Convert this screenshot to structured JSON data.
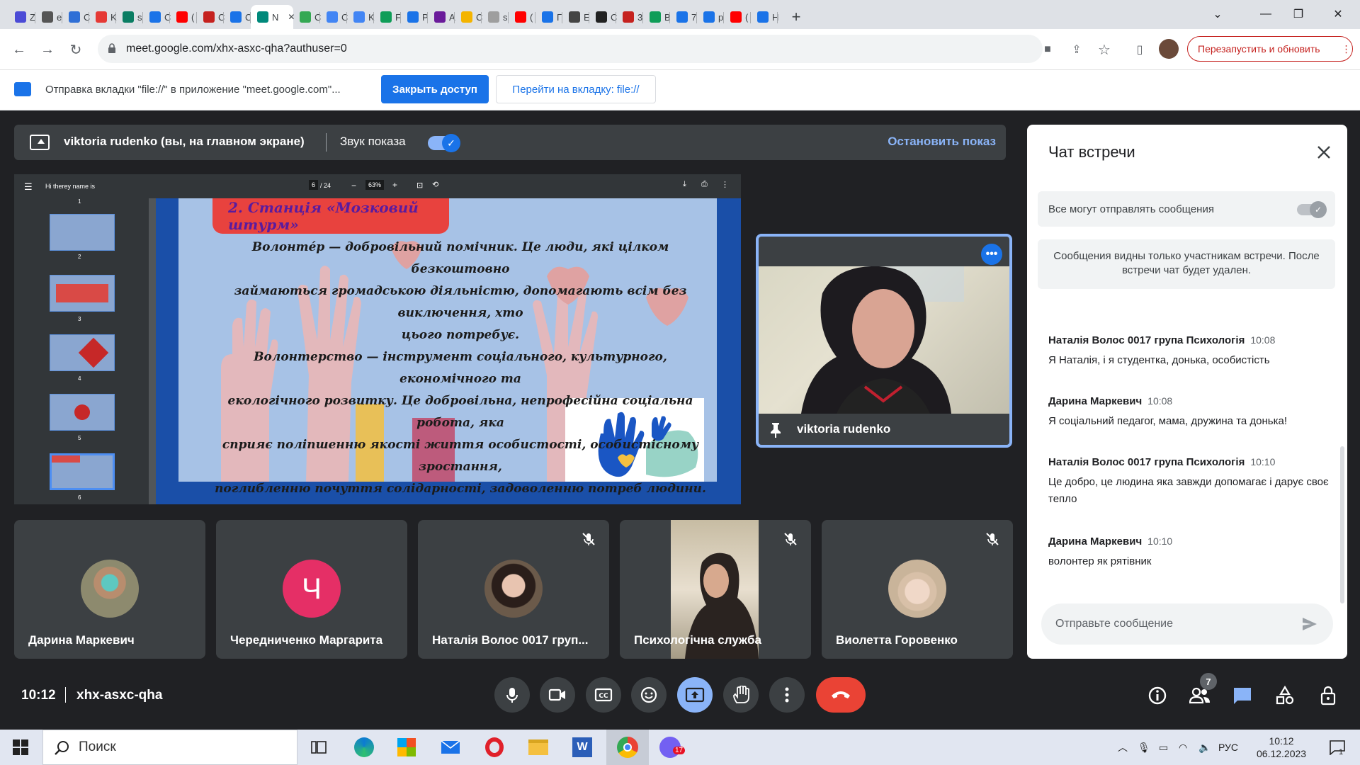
{
  "browser": {
    "tabs": [
      {
        "letter": "Z",
        "color": "#4b4bd6"
      },
      {
        "letter": "e",
        "color": "#555"
      },
      {
        "letter": "C",
        "color": "#2f6fd6"
      },
      {
        "letter": "K",
        "color": "#e53935"
      },
      {
        "letter": "s",
        "color": "#0a7d63"
      },
      {
        "letter": "C",
        "color": "#1a73e8"
      },
      {
        "letter": "(",
        "color": "#ff0000"
      },
      {
        "letter": "C",
        "color": "#c5221f"
      },
      {
        "letter": "C",
        "color": "#1a73e8"
      },
      {
        "letter": "N",
        "color": "#00897b",
        "active": true
      },
      {
        "letter": "C",
        "color": "#34a853"
      },
      {
        "letter": "C",
        "color": "#4285f4"
      },
      {
        "letter": "K",
        "color": "#4285f4"
      },
      {
        "letter": "F",
        "color": "#0f9d58"
      },
      {
        "letter": "P",
        "color": "#1a73e8"
      },
      {
        "letter": "A",
        "color": "#6a1b9a"
      },
      {
        "letter": "C",
        "color": "#f4b400"
      },
      {
        "letter": "s",
        "color": "#9e9e9e"
      },
      {
        "letter": "(",
        "color": "#ff0000"
      },
      {
        "letter": "Г",
        "color": "#1a73e8"
      },
      {
        "letter": "E",
        "color": "#444"
      },
      {
        "letter": "C",
        "color": "#222"
      },
      {
        "letter": "3",
        "color": "#c5221f"
      },
      {
        "letter": "B",
        "color": "#0f9d58"
      },
      {
        "letter": "7",
        "color": "#1a73e8"
      },
      {
        "letter": "p",
        "color": "#1a73e8"
      },
      {
        "letter": "(",
        "color": "#ff0000"
      },
      {
        "letter": "H",
        "color": "#1a73e8"
      }
    ],
    "new_tab": "+",
    "url": "meet.google.com/xhx-asxc-qha?authuser=0",
    "relaunch_label": "Перезапустить и обновить",
    "infobar": {
      "text": "Отправка вкладки \"file://\" в приложение \"meet.google.com\"...",
      "close_access": "Закрыть доступ",
      "goto_tab": "Перейти на вкладку: file://"
    }
  },
  "meet": {
    "presenting": {
      "name": "viktoria rudenko (вы, на главном экране)",
      "sound_label": "Звук показа",
      "stop_label": "Остановить показ"
    },
    "pdf": {
      "filename": "Hi therey name is",
      "page": "6",
      "pages": "/ 24",
      "zoom": "63%",
      "thumb_numbers": [
        "1",
        "2",
        "3",
        "4",
        "5",
        "6"
      ]
    },
    "slide": {
      "title": "2. Станція «Мозковий штурм»",
      "lines": [
        "Волонтéр — добровільний помічник. Це люди, які цілком безкоштовно",
        "займаються громадською діяльністю, допомагають всім без виключення, хто",
        "цього потребує.",
        "Волонтерство — інструмент соціального, культурного, економічного та",
        "екологічного розвитку. Це добровільна, непрофесійна соціальна робота, яка",
        "сприяє поліпшенню якості життя особистості, особистісному зростання,",
        "поглибленню почуття солідарності, задоволенню потреб людини."
      ]
    },
    "pinned": {
      "name": "viktoria rudenko"
    },
    "participants": [
      {
        "name": "Дарина Маркевич",
        "avatar_color": "#8d8a6e",
        "muted": false
      },
      {
        "name": "Чередниченко Маргарита",
        "avatar_letter": "Ч",
        "avatar_color": "#e52f66",
        "muted": false
      },
      {
        "name": "Наталія Волос 0017 груп...",
        "avatar_color": "#6b5a4a",
        "muted": true
      },
      {
        "name": "Психологічна служба",
        "muted": true,
        "video": true
      },
      {
        "name": "Виолетта Горовенко",
        "avatar_color": "#c9b49a",
        "muted": true
      }
    ],
    "time": "10:12",
    "meeting_code": "xhx-asxc-qha",
    "people_count": "7",
    "chat": {
      "title": "Чат встречи",
      "allow_label": "Все могут отправлять сообщения",
      "notice": "Сообщения видны только участникам встречи. После встречи чат будет удален.",
      "messages": [
        {
          "sender": "Наталія Волос 0017 група Психологія",
          "time": "10:08",
          "text": "Я Наталія, і я студентка, донька, особистість"
        },
        {
          "sender": "Дарина Маркевич",
          "time": "10:08",
          "text": "Я соціальний педагог, мама, дружина та донька!"
        },
        {
          "sender": "Наталія Волос 0017 група Психологія",
          "time": "10:10",
          "text": "Це добро, це людина яка завжди допомагає і дарує своє тепло"
        },
        {
          "sender": "Дарина Маркевич",
          "time": "10:10",
          "text": "волонтер як рятівник"
        }
      ],
      "input_placeholder": "Отправьте сообщение"
    }
  },
  "taskbar": {
    "search_label": "Поиск",
    "lang": "РУС",
    "time": "10:12",
    "date": "06.12.2023",
    "notif_count": "1",
    "viber_badge": "17"
  }
}
